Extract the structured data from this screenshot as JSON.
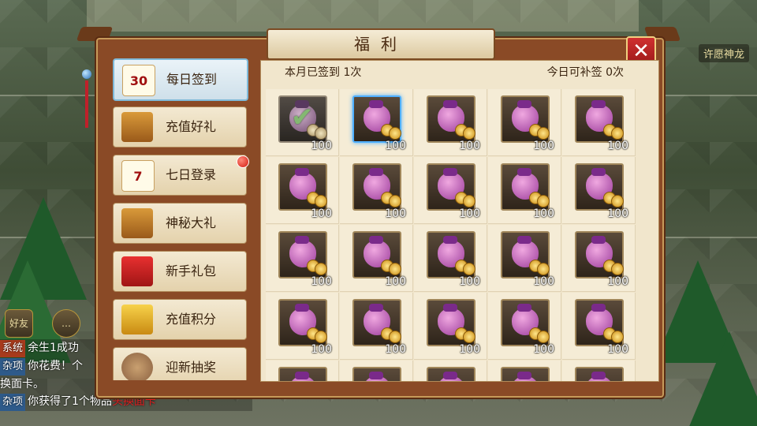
{
  "scene": {
    "wish_dragon": "许愿神龙"
  },
  "chat": {
    "friend_label": "好友",
    "lines": [
      {
        "tag": "系统",
        "tag_type": "sys",
        "text": "余生1成功",
        "highlight": ""
      },
      {
        "tag": "杂项",
        "tag_type": "misc",
        "text": "你花费！个",
        "highlight": ""
      },
      {
        "tag": "",
        "tag_type": "",
        "text": "换面卡。",
        "highlight": ""
      },
      {
        "tag": "杂项",
        "tag_type": "misc",
        "text": "你获得了1个物品",
        "highlight": "头换面卡"
      }
    ]
  },
  "window": {
    "title": "福利",
    "close_label": "✕"
  },
  "sidebar": {
    "items": [
      {
        "label": "每日签到",
        "icon": "calendar-30-icon",
        "glyph": "30",
        "active": true,
        "dot": false
      },
      {
        "label": "充值好礼",
        "icon": "treasure-chest-icon",
        "glyph": "",
        "active": false,
        "dot": false
      },
      {
        "label": "七日登录",
        "icon": "calendar-7-icon",
        "glyph": "7",
        "active": false,
        "dot": true
      },
      {
        "label": "神秘大礼",
        "icon": "mystery-chest-icon",
        "glyph": "",
        "active": false,
        "dot": false
      },
      {
        "label": "新手礼包",
        "icon": "gift-box-icon",
        "glyph": "",
        "active": false,
        "dot": false
      },
      {
        "label": "充值积分",
        "icon": "gold-pile-icon",
        "glyph": "",
        "active": false,
        "dot": false
      },
      {
        "label": "迎新抽奖",
        "icon": "lottery-disk-icon",
        "glyph": "",
        "active": false,
        "dot": false
      }
    ]
  },
  "checkin": {
    "signed_text": "本月已签到 1次",
    "makeup_text": "今日可补签 0次",
    "reward_qty": "100",
    "total_cells": 25,
    "done_count": 1,
    "selected_index": 1
  }
}
